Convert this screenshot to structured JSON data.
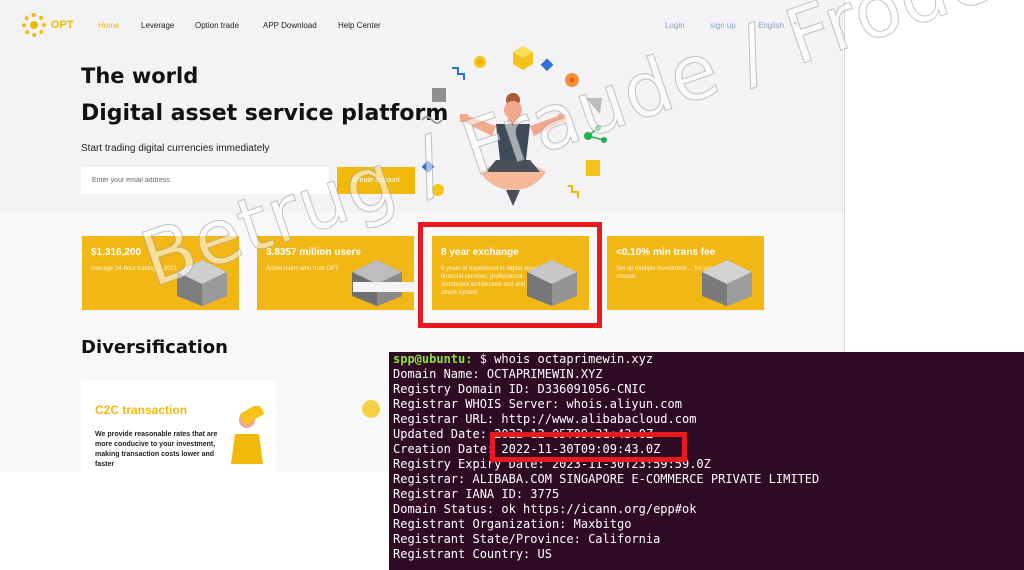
{
  "nav": {
    "logo_text": "OPT",
    "items": [
      "Home",
      "Leverage",
      "Option trade",
      "APP Download",
      "Help Center"
    ],
    "login": "Login",
    "signup": "sign up",
    "language": "English"
  },
  "hero": {
    "title_line1": "The world",
    "title_line2": "Digital asset service platform",
    "subtitle": "Start trading digital currencies immediately",
    "email_placeholder": "Enter your email address",
    "create_button": "Create account"
  },
  "cards": [
    {
      "title": "$1,316,200",
      "desc": "Average 24-hour trading ... 2021"
    },
    {
      "title": "3.8357 million users",
      "desc": "Active users who trust OPT"
    },
    {
      "title": "8 year exchange",
      "desc": "8 years of experience in digital asset financial services, professional distributed architecture and anti DDOS attack system"
    },
    {
      "title": "<0.10% min trans fee",
      "desc": "Set up multiple investment ... for users to choose"
    }
  ],
  "diversification": {
    "title": "Diversification",
    "c2c_title": "C2C transaction",
    "c2c_desc": "We provide reasonable rates that are more conducive to your investment, making transaction costs lower and faster"
  },
  "terminal": {
    "prompt_user": "spp@ubuntu:",
    "prompt_cmd": " $ whois octaprimewin.xyz",
    "lines": [
      "Domain Name: OCTAPRIMEWIN.XYZ",
      "Registry Domain ID: D336091056-CNIC",
      "Registrar WHOIS Server: whois.aliyun.com",
      "Registrar URL: http://www.alibabacloud.com",
      "Updated Date: 2022-12-05T09:31:43.0Z",
      "Creation Date: 2022-11-30T09:09:43.0Z",
      "Registry Expiry Date: 2023-11-30T23:59:59.0Z",
      "Registrar: ALIBABA.COM SINGAPORE E-COMMERCE PRIVATE LIMITED",
      "Registrar IANA ID: 3775",
      "Domain Status: ok https://icann.org/epp#ok",
      "Registrant Organization: Maxbitgo",
      "Registrant State/Province: California",
      "Registrant Country: US"
    ]
  },
  "watermark": "Betrug / Fraude / Frode / Fraud",
  "colors": {
    "brand_yellow": "#f0b90b",
    "highlight_red": "#e8191f",
    "terminal_bg": "#2f0a24",
    "prompt_green": "#8ae234"
  }
}
